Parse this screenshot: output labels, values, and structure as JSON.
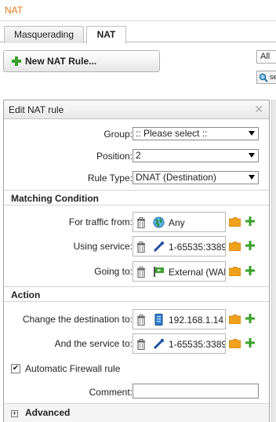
{
  "page": {
    "title": "NAT"
  },
  "tabs": [
    {
      "label": "Masquerading"
    },
    {
      "label": "NAT"
    }
  ],
  "toolbar": {
    "new_rule_label": "New NAT Rule...",
    "filter_value": "All",
    "search_label": "se"
  },
  "dialog": {
    "title": "Edit NAT rule",
    "group": {
      "label": "Group:",
      "value": ":: Please select ::"
    },
    "position": {
      "label": "Position:",
      "value": "2"
    },
    "rule_type": {
      "label": "Rule Type:",
      "value": "DNAT (Destination)"
    },
    "matching_condition": {
      "heading": "Matching Condition",
      "traffic_from": {
        "label": "For traffic from:",
        "value": "Any"
      },
      "using_service": {
        "label": "Using service:",
        "value": "1-65535:3389"
      },
      "going_to": {
        "label": "Going to:",
        "value": "External (WAN)"
      }
    },
    "action": {
      "heading": "Action",
      "change_destination": {
        "label": "Change the destination to:",
        "value": "192.168.1.14"
      },
      "and_service": {
        "label": "And the service to:",
        "value": "1-65535:3389"
      }
    },
    "auto_firewall": {
      "label": "Automatic Firewall rule",
      "checked": true
    },
    "comment": {
      "label": "Comment:",
      "value": ""
    },
    "advanced": {
      "label": "Advanced"
    }
  },
  "colors": {
    "accent_orange": "#e07b1f",
    "plus_green": "#3aa12a",
    "folder_orange": "#f0a21c"
  }
}
